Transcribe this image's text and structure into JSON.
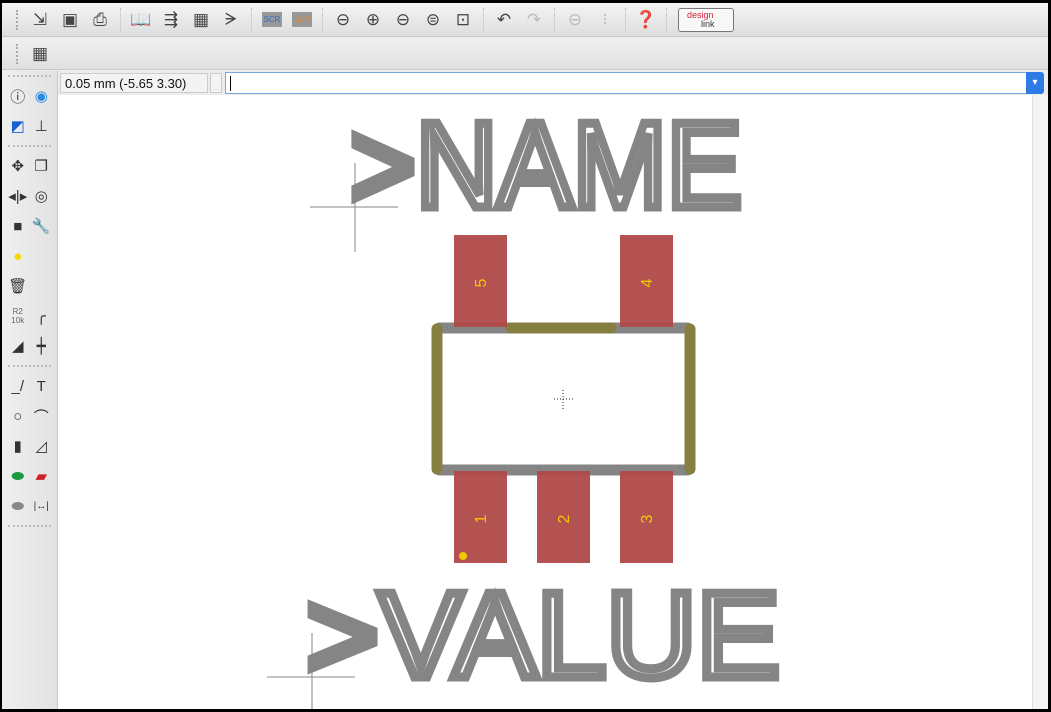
{
  "toolbar": {
    "icons": [
      "open-icon",
      "save-icon",
      "print-icon",
      "library-icon",
      "pin-swap-icon",
      "ic-icon",
      "gate-icon",
      "script-icon",
      "ulp-icon",
      "zoom-fit-icon",
      "zoom-in-icon",
      "zoom-out-icon",
      "zoom-redraw-icon",
      "zoom-select-icon",
      "undo-icon",
      "redo-icon",
      "stop-icon",
      "go-icon",
      "help-icon"
    ],
    "script_label": "SCR",
    "ulp_label": "ULP",
    "designlink_top": "design",
    "designlink_bottom": "link"
  },
  "toolbar2": {
    "grid_icon": "grid-icon"
  },
  "command": {
    "coordinates": "0.05 mm (-5.65 3.30)",
    "value": ""
  },
  "left_tools": [
    "info",
    "show",
    "display",
    "mark",
    "move",
    "copy",
    "mirror",
    "rotate",
    "group",
    "change",
    "paste",
    "delete",
    "name-value",
    "smash",
    "miter",
    "split",
    "wire",
    "text",
    "circle",
    "arc",
    "rect",
    "polygon",
    "pad",
    "smd",
    "hole",
    "dimension"
  ],
  "left_labels": {
    "r2": "R2",
    "k10": "10k"
  },
  "footprint": {
    "name_text": ">NAME",
    "value_text": ">VALUE",
    "pads": [
      {
        "label": "5"
      },
      {
        "label": "4"
      },
      {
        "label": "1"
      },
      {
        "label": "2"
      },
      {
        "label": "3"
      }
    ],
    "colors": {
      "pad": "#b04848",
      "outline": "#858585",
      "silk": "#858040",
      "pad_label": "#f0c800"
    }
  }
}
